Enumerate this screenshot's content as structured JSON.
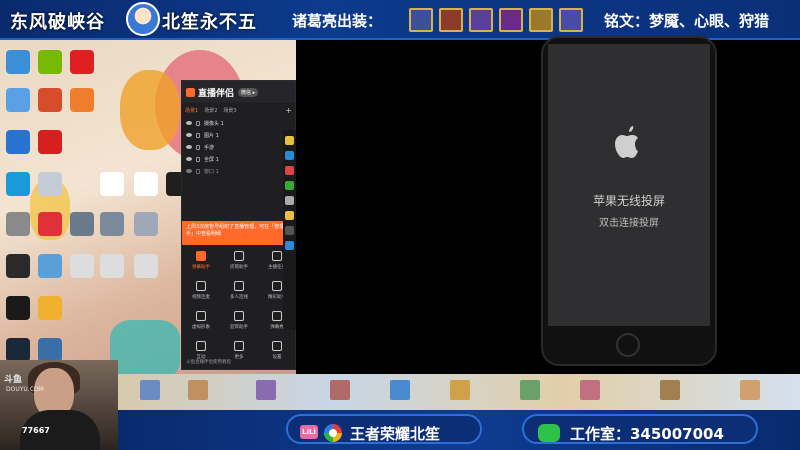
{
  "top_banner": {
    "left_title": "东风破峡谷",
    "right_title": "北笙永不五",
    "equipment_label": "诸葛亮出装：",
    "equipment_icons": [
      "item-icon-1",
      "item-icon-2",
      "item-icon-3",
      "item-icon-4",
      "item-icon-5",
      "item-icon-6"
    ],
    "runes_label": "铭文：梦魇、心眼、狩猎"
  },
  "app_window": {
    "title": "直播伴侣",
    "badge": "微信 ▸",
    "tabs": [
      "场景1",
      "场景2",
      "场景3"
    ],
    "add_label": "+",
    "sources": [
      {
        "label": "摄像头 1"
      },
      {
        "label": "图片 1"
      },
      {
        "label": "手游"
      },
      {
        "label": "全屏 1"
      },
      {
        "label": "窗口 1"
      }
    ],
    "notice": "上周3次房管号组织了直播管理，可在「管理助手」中查看明细",
    "tools": [
      {
        "label": "弹幕助手",
        "orange": true
      },
      {
        "label": "房管助手",
        "orange": false
      },
      {
        "label": "主播任务",
        "orange": false
      },
      {
        "label": "视频连麦",
        "orange": false
      },
      {
        "label": "多人连线",
        "orange": false
      },
      {
        "label": "精彩助手",
        "orange": false
      },
      {
        "label": "虚拟形象",
        "orange": false
      },
      {
        "label": "迎宾助手",
        "orange": false
      },
      {
        "label": "弹幕秀",
        "orange": false
      },
      {
        "label": "互动",
        "orange": false
      },
      {
        "label": "更多",
        "orange": false
      },
      {
        "label": "设置",
        "orange": false
      }
    ],
    "footer": "斗鱼直播伴侣使用教程"
  },
  "airplay": {
    "title": "苹果无线投屏",
    "subtitle": "双击连接投屏"
  },
  "webcam": {
    "platform": "斗鱼",
    "platform_sub": "DOUYU.COM",
    "room_number": "77667"
  },
  "bottom_bar": {
    "left_badge": "LiLi",
    "left_text": "王者荣耀北笙",
    "right_text": "工作室：345007004"
  },
  "colors": {
    "banner_blue": "#0d3a8c",
    "accent_orange": "#ff6a2a",
    "wechat_green": "#2fc24a"
  }
}
